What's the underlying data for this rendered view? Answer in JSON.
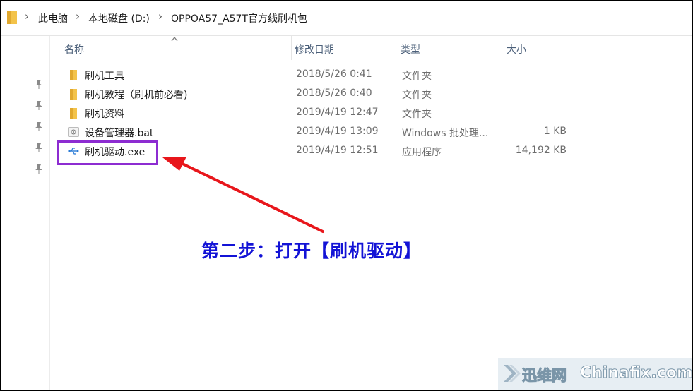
{
  "breadcrumb": {
    "items": [
      "此电脑",
      "本地磁盘 (D:)",
      "OPPOA57_A57T官方线刷机包"
    ]
  },
  "columns": {
    "name": "名称",
    "date": "修改日期",
    "type": "类型",
    "size": "大小"
  },
  "files": [
    {
      "name": "刷机工具",
      "date": "2018/5/26 0:41",
      "type": "文件夹",
      "size": "",
      "icon": "folder-icon"
    },
    {
      "name": "刷机教程（刷机前必看)",
      "date": "2018/5/26 0:40",
      "type": "文件夹",
      "size": "",
      "icon": "folder-icon"
    },
    {
      "name": "刷机资料",
      "date": "2019/4/19 12:47",
      "type": "文件夹",
      "size": "",
      "icon": "folder-icon"
    },
    {
      "name": "设备管理器.bat",
      "date": "2019/4/19 13:09",
      "type": "Windows 批处理...",
      "size": "1 KB",
      "icon": "batch-file-icon"
    },
    {
      "name": "刷机驱动.exe",
      "date": "2019/4/19 12:51",
      "type": "应用程序",
      "size": "14,192 KB",
      "icon": "usb-icon"
    }
  ],
  "annotation": {
    "text": "第二步：打开【刷机驱动】",
    "color": "#1313d6",
    "arrow_color": "#e8161b",
    "highlight_color": "#8d2cd1"
  },
  "watermark": {
    "cn": "迅维网",
    "en": "Chinafix.com"
  },
  "colors": {
    "folder": "#f3c34a",
    "header_text": "#4c607a"
  }
}
